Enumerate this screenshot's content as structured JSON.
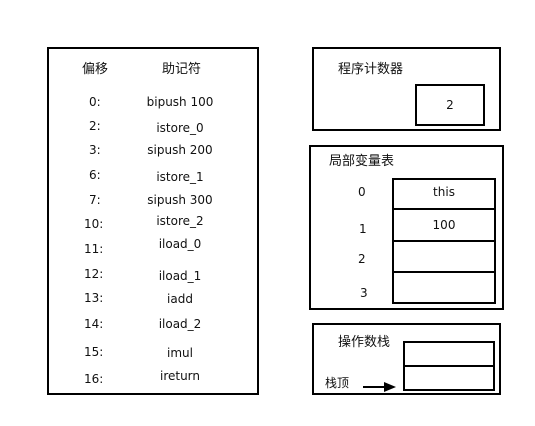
{
  "instructions": {
    "header_offset": "偏移",
    "header_mnemonic": "助记符",
    "rows": [
      {
        "offset": "0:",
        "op": "bipush 100"
      },
      {
        "offset": "2:",
        "op": "istore_0"
      },
      {
        "offset": "3:",
        "op": "sipush  200"
      },
      {
        "offset": "6:",
        "op": "istore_1"
      },
      {
        "offset": "7:",
        "op": "sipush  300"
      },
      {
        "offset": "10:",
        "op": "istore_2"
      },
      {
        "offset": "11:",
        "op": "iload_0"
      },
      {
        "offset": "12:",
        "op": "iload_1"
      },
      {
        "offset": "13:",
        "op": "iadd"
      },
      {
        "offset": "14:",
        "op": "iload_2"
      },
      {
        "offset": "15:",
        "op": "imul"
      },
      {
        "offset": "16:",
        "op": "ireturn"
      }
    ]
  },
  "pc": {
    "title": "程序计数器",
    "value": "2"
  },
  "locals": {
    "title": "局部变量表",
    "slots": [
      {
        "index": "0",
        "value": "this"
      },
      {
        "index": "1",
        "value": "100"
      },
      {
        "index": "2",
        "value": ""
      },
      {
        "index": "3",
        "value": ""
      }
    ]
  },
  "stack": {
    "title": "操作数栈",
    "top_label": "栈顶"
  }
}
